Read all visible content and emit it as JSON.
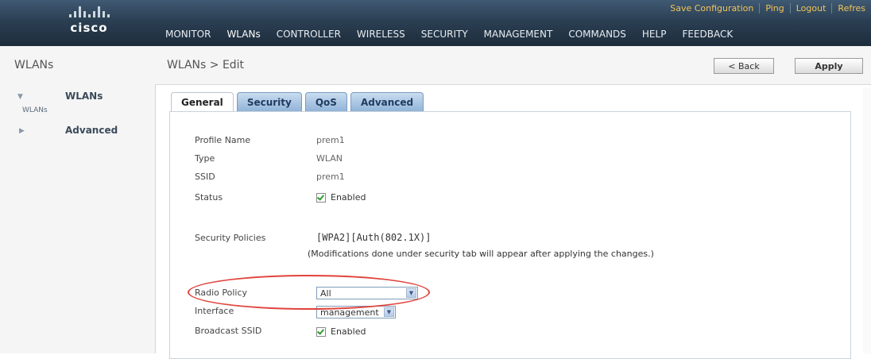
{
  "header": {
    "brand": "cisco",
    "toplinks": [
      "Save Configuration",
      "Ping",
      "Logout",
      "Refres"
    ],
    "nav": [
      "MONITOR",
      "WLANs",
      "CONTROLLER",
      "WIRELESS",
      "SECURITY",
      "MANAGEMENT",
      "COMMANDS",
      "HELP",
      "FEEDBACK"
    ],
    "active_nav": "WLANs"
  },
  "sidebar": {
    "title": "WLANs",
    "items": [
      {
        "label": "WLANs",
        "sub": "WLANs",
        "expanded": true
      },
      {
        "label": "Advanced",
        "expanded": false
      }
    ]
  },
  "page": {
    "title": "WLANs > Edit",
    "back_label": "< Back",
    "apply_label": "Apply"
  },
  "tabs": [
    "General",
    "Security",
    "QoS",
    "Advanced"
  ],
  "active_tab": "General",
  "form": {
    "profile_name_label": "Profile Name",
    "profile_name": "prem1",
    "type_label": "Type",
    "type": "WLAN",
    "ssid_label": "SSID",
    "ssid": "prem1",
    "status_label": "Status",
    "status_checkbox": "Enabled",
    "security_policies_label": "Security Policies",
    "security_policies": "[WPA2][Auth(802.1X)]",
    "security_note": "(Modifications done under security tab will appear after applying the changes.)",
    "radio_policy_label": "Radio Policy",
    "radio_policy": "All",
    "interface_label": "Interface",
    "interface": "management",
    "broadcast_ssid_label": "Broadcast SSID",
    "broadcast_checkbox": "Enabled"
  },
  "colors": {
    "header": "#2b3f53",
    "nav_link": "#e8edf2",
    "toplink": "#f2c35a",
    "tab": "#8fb2d8",
    "highlight": "#e0443d"
  }
}
